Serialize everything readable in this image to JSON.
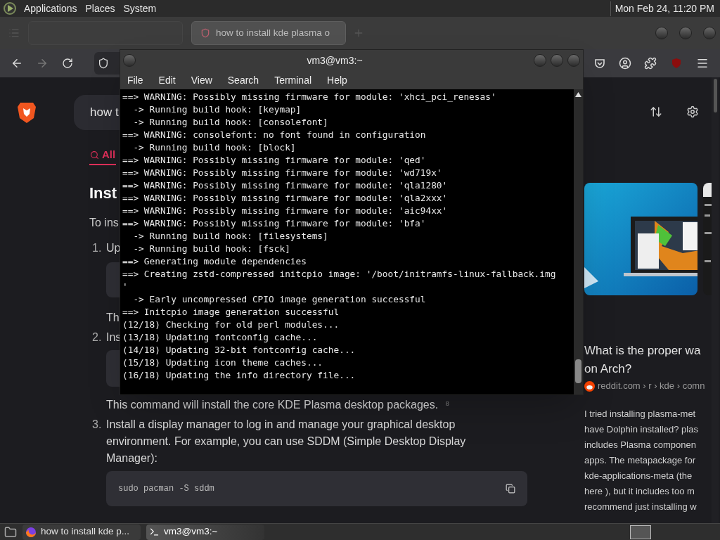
{
  "top_panel": {
    "menus": [
      "Applications",
      "Places",
      "System"
    ],
    "clock": "Mon Feb 24, 11:20 PM"
  },
  "browser": {
    "tabs": [
      {
        "selected": false
      },
      {
        "label": "how to install kde plasma o",
        "selected": true
      }
    ],
    "search_query": "how t",
    "filter_tabs": [
      {
        "label": "All",
        "selected": true
      }
    ],
    "answer": {
      "heading": "Inst",
      "intro": "To ins",
      "steps": [
        {
          "number": "1.",
          "text": "Up",
          "note": "Th"
        },
        {
          "number": "2.",
          "text": "Ins",
          "note": "This command will install the core KDE Plasma desktop packages. $^{8}$"
        },
        {
          "number": "3.",
          "text": "Install a display manager to log in and manage your graphical desktop environment. For example, you can use SDDM (Simple Desktop Display Manager):",
          "code": "sudo pacman -S sddm"
        }
      ]
    },
    "result": {
      "title": "What is the proper wa",
      "title_2": "on Arch?",
      "source": "reddit.com › r › kde › comn",
      "lines": [
        "I tried installing plasma-met",
        "have Dolphin installed? plas",
        "includes Plasma componen",
        "apps. The metapackage for",
        "kde-applications-meta (the",
        "here ), but it includes too m",
        "recommend just installing w"
      ]
    }
  },
  "terminal": {
    "title": "vm3@vm3:~",
    "menus": [
      "File",
      "Edit",
      "View",
      "Search",
      "Terminal",
      "Help"
    ],
    "lines": [
      "==> WARNING: Possibly missing firmware for module: 'xhci_pci_renesas'",
      "  -> Running build hook: [keymap]",
      "  -> Running build hook: [consolefont]",
      "==> WARNING: consolefont: no font found in configuration",
      "  -> Running build hook: [block]",
      "==> WARNING: Possibly missing firmware for module: 'qed'",
      "==> WARNING: Possibly missing firmware for module: 'wd719x'",
      "==> WARNING: Possibly missing firmware for module: 'qla1280'",
      "==> WARNING: Possibly missing firmware for module: 'qla2xxx'",
      "==> WARNING: Possibly missing firmware for module: 'aic94xx'",
      "==> WARNING: Possibly missing firmware for module: 'bfa'",
      "  -> Running build hook: [filesystems]",
      "  -> Running build hook: [fsck]",
      "==> Generating module dependencies",
      "==> Creating zstd-compressed initcpio image: '/boot/initramfs-linux-fallback.img",
      "'",
      "  -> Early uncompressed CPIO image generation successful",
      "==> Initcpio image generation successful",
      "(12/18) Checking for old perl modules...",
      "(13/18) Updating fontconfig cache...",
      "(14/18) Updating 32-bit fontconfig cache...",
      "(15/18) Updating icon theme caches...",
      "(16/18) Updating the info directory file..."
    ]
  },
  "taskbar": {
    "items": [
      {
        "label": "how to install kde p...",
        "kind": "browser",
        "selected": false
      },
      {
        "label": "vm3@vm3:~",
        "kind": "terminal",
        "selected": true
      }
    ]
  }
}
